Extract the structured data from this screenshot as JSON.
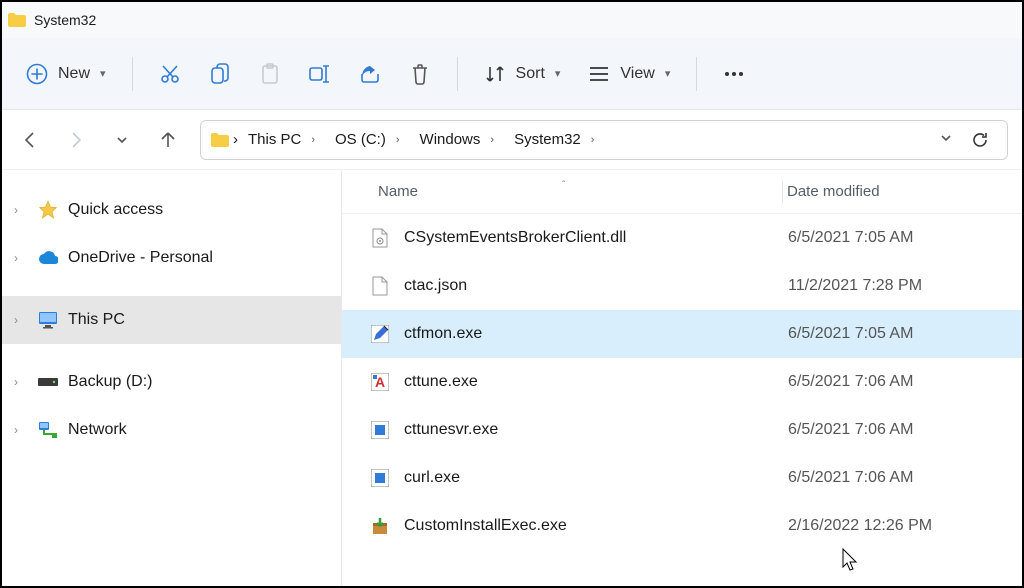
{
  "window": {
    "title": "System32"
  },
  "toolbar": {
    "new_label": "New",
    "sort_label": "Sort",
    "view_label": "View"
  },
  "breadcrumb": {
    "segments": [
      "This PC",
      "OS (C:)",
      "Windows",
      "System32"
    ]
  },
  "sidebar": {
    "items": [
      {
        "label": "Quick access",
        "icon": "star"
      },
      {
        "label": "OneDrive - Personal",
        "icon": "cloud"
      },
      {
        "label": "This PC",
        "icon": "pc",
        "selected": true
      },
      {
        "label": "Backup (D:)",
        "icon": "drive"
      },
      {
        "label": "Network",
        "icon": "network"
      }
    ]
  },
  "columns": {
    "name": "Name",
    "date": "Date modified"
  },
  "files": [
    {
      "name": "CSystemEventsBrokerClient.dll",
      "date": "6/5/2021 7:05 AM",
      "icon": "dll"
    },
    {
      "name": "ctac.json",
      "date": "11/2/2021 7:28 PM",
      "icon": "file"
    },
    {
      "name": "ctfmon.exe",
      "date": "6/5/2021 7:05 AM",
      "icon": "exe-pen",
      "selected": true
    },
    {
      "name": "cttune.exe",
      "date": "6/5/2021 7:06 AM",
      "icon": "exe-a"
    },
    {
      "name": "cttunesvr.exe",
      "date": "6/5/2021 7:06 AM",
      "icon": "exe-win"
    },
    {
      "name": "curl.exe",
      "date": "6/5/2021 7:06 AM",
      "icon": "exe-win"
    },
    {
      "name": "CustomInstallExec.exe",
      "date": "2/16/2022 12:26 PM",
      "icon": "exe-box"
    }
  ]
}
